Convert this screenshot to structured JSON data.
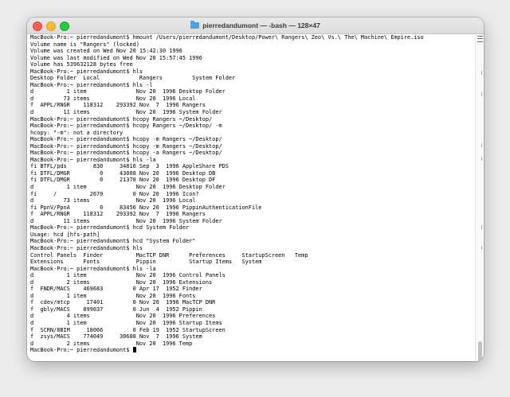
{
  "window": {
    "title": "pierredandumont — -bash — 128×47"
  },
  "terminal": {
    "lines": [
      "MacBook-Pro:~ pierredandumont$ hmount /Users/pierredandumont/Desktop/Power\\ Rangers\\ Zeo\\ Vs.\\ The\\ Machine\\ Empire.iso",
      "Volume name is \"Rangers\" (locked)",
      "Volume was created on Wed Nov 20 15:42:30 1996",
      "Volume was last modified on Wed Nov 20 15:57:45 1996",
      "Volume has 539632128 bytes free",
      "MacBook-Pro:~ pierredandumont$ hls",
      "Desktop Folder  Local            Rangers         System Folder",
      "MacBook-Pro:~ pierredandumont$ hls -l",
      "d          1 item               Nov 20  1996 Desktop Folder",
      "d         73 items              Nov 20  1996 Local",
      "f  APPL/RNGR    118312    293392 Nov  7  1996 Rangers",
      "d         11 items              Nov 20  1996 System Folder",
      "MacBook-Pro:~ pierredandumont$ hcopy Rangers ~/Desktop/",
      "MacBook-Pro:~ pierredandumont$ hcopy Rangers ~/Desktop/ -m",
      "hcopy: \"-m\": not a directory",
      "MacBook-Pro:~ pierredandumont$ hcopy -m Rangers ~/Desktop/",
      "MacBook-Pro:~ pierredandumont$ hcopy -m Rangers ~/Desktop/",
      "MacBook-Pro:~ pierredandumont$ hcopy -a Rangers ~/Desktop/",
      "MacBook-Pro:~ pierredandumont$ hls -la",
      "fi BTFL/pds        830     34816 Sep  3  1996 AppleShare PDS",
      "fi DTFL/DMGR         0     43008 Nov 20  1996 Desktop DB",
      "fi DTFL/DMGR         0     21378 Nov 20  1996 Desktop DF",
      "d          1 item               Nov 20  1996 Desktop Folder",
      "fi     /          2670         0 Nov 20  1996 Icon?",
      "d         73 items              Nov 20  1996 Local",
      "fi PpnV/PpnA         0     83456 Nov 20  1996 PippinAuthenticationFile",
      "f  APPL/RNGR    118312    293392 Nov  7  1996 Rangers",
      "d         11 items              Nov 20  1996 System Folder",
      "MacBook-Pro:~ pierredandumont$ hcd System Folder",
      "Usage: hcd [hfs-path]",
      "MacBook-Pro:~ pierredandumont$ hcd \"System Folder\"",
      "MacBook-Pro:~ pierredandumont$ hls",
      "Control Panels  Finder          MacTCP DNR      Preferences     StartupScreen   Temp",
      "Extensions      Fonts           Pippin          Startup Items   System",
      "MacBook-Pro:~ pierredandumont$ hls -la",
      "d          1 item               Nov 20  1996 Control Panels",
      "d          2 items              Nov 20  1996 Extensions",
      "f  FNDR/MACS    469683         0 Apr 17  1952 Finder",
      "d          1 item               Nov 20  1996 Fonts",
      "f  cdev/mtcp     17401         0 Nov 20  1996 MacTCP DNR",
      "f  gbly/MACS    899037         0 Jun  4  1952 Pippin",
      "d          4 items              Nov 20  1996 Preferences",
      "d          1 item               Nov 20  1996 Startup Items",
      "f  SCRN/8BIM     18066         0 Feb 19  1952 StartupScreen",
      "f  zsys/MACS    774049     30688 Nov  7  1996 System",
      "d          2 items              Nov 20  1996 Temp"
    ],
    "prompt": "MacBook-Pro:~ pierredandumont$ "
  }
}
